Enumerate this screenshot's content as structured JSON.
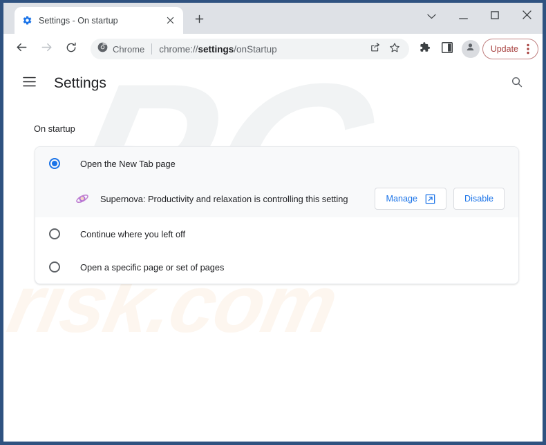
{
  "window": {
    "controls": [
      {
        "name": "tab-search-button",
        "icon": "chevron-down-icon",
        "label": ""
      },
      {
        "name": "minimize-button",
        "icon": "minimize-icon",
        "label": ""
      },
      {
        "name": "maximize-button",
        "icon": "maximize-icon",
        "label": ""
      },
      {
        "name": "close-window-button",
        "icon": "close-icon",
        "label": ""
      }
    ]
  },
  "tab": {
    "title": "Settings - On startup",
    "favicon": "settings-gear-icon",
    "close_icon": "close-icon",
    "new_tab_icon": "plus-icon"
  },
  "toolbar": {
    "back_icon": "back-arrow-icon",
    "forward_icon": "forward-arrow-icon",
    "reload_icon": "reload-icon",
    "omnibox": {
      "chip_icon": "chrome-logo-icon",
      "chip_label": "Chrome",
      "url_prefix": "chrome://",
      "url_bold": "settings",
      "url_suffix": "/onStartup",
      "share_icon": "share-icon",
      "bookmark_icon": "star-icon"
    },
    "extensions_icon": "puzzle-piece-icon",
    "side_panel_icon": "side-panel-icon",
    "profile_icon": "avatar-icon",
    "update_label": "Update",
    "update_menu_icon": "three-dots-vertical-icon",
    "update_accent_color": "#a94442"
  },
  "settings": {
    "menu_icon": "hamburger-menu-icon",
    "title": "Settings",
    "search_icon": "search-icon",
    "section_label": "On startup",
    "accent_color": "#1a73e8",
    "options": [
      {
        "label": "Open the New Tab page",
        "selected": true
      },
      {
        "label": "Continue where you left off",
        "selected": false
      },
      {
        "label": "Open a specific page or set of pages",
        "selected": false
      }
    ],
    "extension_notice": {
      "icon": "supernova-planet-icon",
      "text": "Supernova: Productivity and relaxation is controlling this setting",
      "manage_label": "Manage",
      "manage_icon": "external-link-icon",
      "disable_label": "Disable"
    }
  },
  "watermarks": {
    "primary": "PC",
    "secondary": "risk.com"
  }
}
